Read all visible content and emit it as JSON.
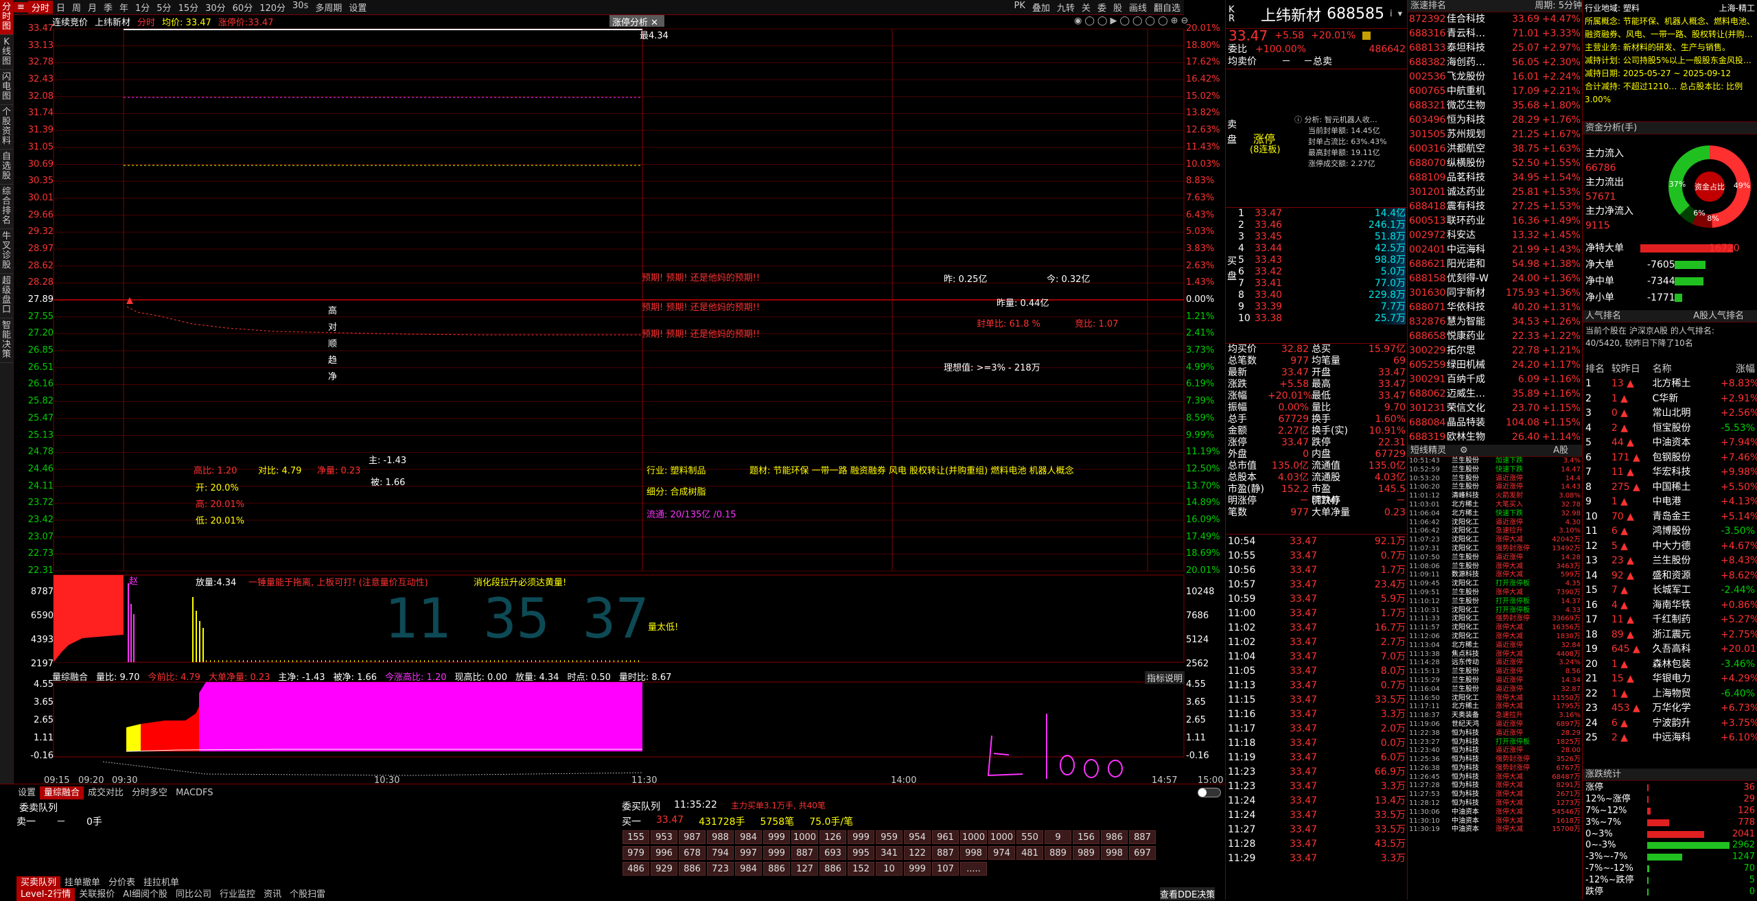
{
  "sidebar": [
    "分时图",
    "K线图",
    "闪电图",
    "个股资料",
    "自选股",
    "综合排名",
    "牛叉诊股",
    "超级盘口",
    "智能决策"
  ],
  "toolbar": {
    "items": [
      "分时",
      "日",
      "周",
      "月",
      "季",
      "年",
      "1分",
      "5分",
      "15分",
      "30分",
      "60分",
      "120分",
      "30s",
      "多周期",
      "设置"
    ],
    "right": [
      "PK",
      "叠加",
      "九转",
      "关",
      "委",
      "股",
      "画线",
      "翻自选"
    ]
  },
  "header2": {
    "tab1": "连续竞价",
    "tab2": "上纬新材",
    "fenshi": "分时",
    "avg_label": "均价: 33.47",
    "rise_label": "涨停价:33.47",
    "analysis_tab": "涨停分析",
    "peak": "最4.34"
  },
  "y_left": [
    "33.47",
    "33.13",
    "32.78",
    "32.43",
    "32.08",
    "31.74",
    "31.39",
    "31.05",
    "30.69",
    "30.35",
    "30.01",
    "29.66",
    "29.32",
    "28.97",
    "28.62",
    "28.28",
    "27.89",
    "27.55",
    "27.20",
    "26.85",
    "26.51",
    "26.16",
    "25.82",
    "25.47",
    "25.13",
    "24.78",
    "24.46",
    "24.11",
    "23.72",
    "23.42",
    "23.07",
    "22.73",
    "22.31"
  ],
  "y_right": [
    "20.01%",
    "18.80%",
    "17.62%",
    "16.42%",
    "15.02%",
    "13.82%",
    "12.63%",
    "11.43%",
    "10.03%",
    "8.83%",
    "7.63%",
    "6.43%",
    "5.03%",
    "3.83%",
    "2.63%",
    "1.43%",
    "0.00%",
    "1.21%",
    "2.41%",
    "3.73%",
    "4.99%",
    "6.19%",
    "7.39%",
    "8.59%",
    "9.99%",
    "11.19%",
    "12.50%",
    "13.70%",
    "14.89%",
    "16.09%",
    "17.49%",
    "18.69%",
    "20.01%"
  ],
  "vol_left": [
    "8787",
    "6590",
    "4393",
    "2197"
  ],
  "vol_right": [
    "10248",
    "7686",
    "5124",
    "2562"
  ],
  "ind_left": [
    "4.55",
    "3.65",
    "2.65",
    "1.11",
    "-0.16"
  ],
  "ind_right": [
    "4.55",
    "3.65",
    "2.65",
    "1.11",
    "-0.16"
  ],
  "time_axis": [
    "09:15",
    "09:20",
    "09:30",
    "10:30",
    "11:30",
    "14:00",
    "14:57",
    "15:00"
  ],
  "annotations": {
    "warn1": "预期! 预期! 还是他妈的预期!!",
    "warn2": "预期! 预期! 还是他妈的预期!!",
    "warn3": "预期! 预期! 还是他妈的预期!!",
    "zuo": "昨: 0.25亿",
    "jin": "今: 0.32亿",
    "zuoliang": "昨量: 0.44亿",
    "fengdan": "封单比: 61.8 %",
    "jingbi": "竞比: 1.07",
    "lixiang": "理想值: >=3% - 218万",
    "vert": [
      "高",
      "对",
      "顺",
      "趋",
      "净"
    ],
    "gaobi": "高比: 1.20",
    "duibi": "对比: 4.79",
    "jingliang": "净量: 0.23",
    "zhu": "主: -1.43",
    "bei": "被: 1.66",
    "kai": "开: 20.0%",
    "gao": "高: 20.01%",
    "di": "低: 20.01%",
    "hangye": "行业: 塑料制品",
    "ticai": "题材: 节能环保 一带一路 融资融券 风电 股权转让(并购重组) 燃料电池 机器人概念",
    "xifen": "细分: 合成树脂",
    "liutong": "流通: 20/135亿 /0.15",
    "fangliang": "放量:4.34",
    "tip1": "一锤量能于拖离, 上板可打! (注意量价互动性)",
    "tip2": "消化段拉升必须达黄量!",
    "liangtai": "量太低!",
    "bigclock": "11 35 37",
    "zhao": "赵"
  },
  "ind_bar": {
    "name": "量综融合",
    "lb": "量比: 9.70",
    "jrb": "今前比: 4.79",
    "dd": "大单净量: 0.23",
    "zj": "主净: -1.43",
    "bj": "被净: 1.66",
    "jjgb": "今涨高比: 1.20",
    "xgb": "现高比: 0.00",
    "fl": "放量: 4.34",
    "sd": "时点: 0.50",
    "lb2": "量时比: 8.67",
    "help": "指标说明"
  },
  "bottom": {
    "tabs1": [
      "设置",
      "量综融合",
      "成交对比",
      "分时多空",
      "MACDFS"
    ],
    "wtdl": "委卖队列",
    "mai1": "卖一",
    "mai1v": "－",
    "mai1c": "0手",
    "tabs2": [
      "买卖队列",
      "挂单撤单",
      "分价表",
      "挂拉机单"
    ],
    "tabs3": [
      "Level-2行情",
      "关联报价",
      "AI细阅个股",
      "同比公司",
      "行业监控",
      "资讯",
      "个股扫雷"
    ],
    "queue_title": "委买队列",
    "queue_time": "11:35:22",
    "queue_sub": "主力买单3.1万手, 共40笔",
    "buy1": "买一",
    "buy1p": "33.47",
    "buy1v": "431728手",
    "buy1n": "5758笔",
    "buy1avg": "75.0手/笔",
    "row1": [
      "155",
      "953",
      "987",
      "988",
      "984",
      "999",
      "1000",
      "126",
      "999",
      "959",
      "954",
      "961",
      "1000",
      "1000",
      "550",
      "9",
      "156",
      "986",
      "887"
    ],
    "row2": [
      "979",
      "996",
      "678",
      "794",
      "997",
      "999",
      "887",
      "693",
      "995",
      "341",
      "122",
      "887",
      "998",
      "974",
      "481",
      "889",
      "989",
      "998",
      "697"
    ],
    "row3": [
      "486",
      "929",
      "886",
      "723",
      "984",
      "886",
      "127",
      "886",
      "152",
      "10",
      "999",
      "107",
      "....."
    ],
    "dde": "查看DDE决策"
  },
  "quote": {
    "name": "上纬新材",
    "code": "688585",
    "price": "33.47",
    "chg": "+5.58",
    "pct": "+20.01%",
    "weibi_lbl": "委比",
    "weibi": "+100.00%",
    "weibi_v": "486642",
    "junmai_lbl": "均卖价",
    "junmai_v": "－",
    "zongmai_lbl": "－总卖",
    "zt": "涨停",
    "zt_sub": "(8连板)",
    "ana_title": "分析: 智元机器人收…",
    "ana1": "当前封单额: 14.45亿",
    "ana2": "封单占流比: 63%.43%",
    "ana3": "最高封单额: 19.11亿",
    "ana4": "涨停成交额: 2.27亿",
    "maisell_lbl": "卖盘",
    "buys": [
      [
        "1",
        "33.47",
        "14.4亿"
      ],
      [
        "2",
        "33.46",
        "246.1万"
      ],
      [
        "3",
        "33.45",
        "51.8万"
      ],
      [
        "4",
        "33.44",
        "42.5万"
      ],
      [
        "5",
        "33.43",
        "98.8万"
      ],
      [
        "6",
        "33.42",
        "5.0万"
      ],
      [
        "7",
        "33.41",
        "77.0万"
      ],
      [
        "8",
        "33.40",
        "229.8万"
      ],
      [
        "9",
        "33.39",
        "7.7万"
      ],
      [
        "10",
        "33.38",
        "25.7万"
      ]
    ],
    "buy_lbl": "买盘",
    "stats": [
      [
        "均买价",
        "32.82",
        "总买",
        "15.97亿"
      ],
      [
        "总笔数",
        "977",
        "均笔量",
        "69"
      ],
      [
        "最新",
        "33.47",
        "开盘",
        "33.47"
      ],
      [
        "涨跌",
        "+5.58",
        "最高",
        "33.47"
      ],
      [
        "涨幅",
        "+20.01%",
        "最低",
        "33.47"
      ],
      [
        "振幅",
        "0.00%",
        "量比",
        "9.70"
      ],
      [
        "总手",
        "67729",
        "换手",
        "1.60%"
      ],
      [
        "金额",
        "2.27亿",
        "换手(实)",
        "10.91%"
      ],
      [
        "涨停",
        "33.47",
        "跌停",
        "22.31"
      ],
      [
        "外盘",
        "0",
        "内盘",
        "67729"
      ],
      [
        "总市值",
        "135.0亿",
        "流通值",
        "135.0亿"
      ],
      [
        "总股本",
        "4.03亿",
        "流通股",
        "4.03亿"
      ],
      [
        "市盈(静)",
        "152.2",
        "市盈(TTM)",
        "145.5"
      ],
      [
        "明涨停",
        "－",
        "明跌停",
        "－"
      ],
      [
        "笔数",
        "977",
        "大单净量",
        "0.23"
      ]
    ],
    "ticks": [
      [
        "10:54",
        "33.47",
        "92.1万"
      ],
      [
        "10:55",
        "33.47",
        "0.7万"
      ],
      [
        "10:56",
        "33.47",
        "1.7万"
      ],
      [
        "10:57",
        "33.47",
        "23.4万"
      ],
      [
        "10:59",
        "33.47",
        "5.9万"
      ],
      [
        "11:00",
        "33.47",
        "1.7万"
      ],
      [
        "11:02",
        "33.47",
        "16.7万"
      ],
      [
        "11:02",
        "33.47",
        "2.7万"
      ],
      [
        "11:04",
        "33.47",
        "7.0万"
      ],
      [
        "11:05",
        "33.47",
        "8.0万"
      ],
      [
        "11:13",
        "33.47",
        "0.7万"
      ],
      [
        "11:15",
        "33.47",
        "33.5万"
      ],
      [
        "11:16",
        "33.47",
        "3.3万"
      ],
      [
        "11:17",
        "33.47",
        "2.0万"
      ],
      [
        "11:18",
        "33.47",
        "0.0万"
      ],
      [
        "11:19",
        "33.47",
        "6.0万"
      ],
      [
        "11:23",
        "33.47",
        "66.9万"
      ],
      [
        "11:23",
        "33.47",
        "3.3万"
      ],
      [
        "11:24",
        "33.47",
        "13.4万"
      ],
      [
        "11:24",
        "33.47",
        "33.5万"
      ],
      [
        "11:27",
        "33.47",
        "33.5万"
      ],
      [
        "11:28",
        "33.47",
        "43.5万"
      ],
      [
        "11:29",
        "33.47",
        "3.3万"
      ]
    ]
  },
  "watch": {
    "head1": "涨速排名",
    "head2": "周期: 5分钟",
    "list": [
      [
        "872392",
        "佳合科技",
        "33.69",
        "+4.47%"
      ],
      [
        "688316",
        "青云科…",
        "71.01",
        "+3.33%"
      ],
      [
        "688133",
        "泰坦科技",
        "25.07",
        "+2.97%"
      ],
      [
        "688382",
        "海创药…",
        "56.05",
        "+2.30%"
      ],
      [
        "002536",
        "飞龙股份",
        "16.01",
        "+2.24%"
      ],
      [
        "600765",
        "中航重机",
        "17.09",
        "+2.21%"
      ],
      [
        "688321",
        "微芯生物",
        "35.68",
        "+1.80%"
      ],
      [
        "603496",
        "恒为科技",
        "28.29",
        "+1.76%"
      ],
      [
        "301505",
        "苏州规划",
        "21.25",
        "+1.67%"
      ],
      [
        "600316",
        "洪都航空",
        "38.75",
        "+1.63%"
      ],
      [
        "688070",
        "纵横股份",
        "52.50",
        "+1.55%"
      ],
      [
        "688109",
        "品茗科技",
        "34.95",
        "+1.54%"
      ],
      [
        "301201",
        "诚达药业",
        "25.81",
        "+1.53%"
      ],
      [
        "688418",
        "震有科技",
        "27.25",
        "+1.53%"
      ],
      [
        "600513",
        "联环药业",
        "16.36",
        "+1.49%"
      ],
      [
        "002972",
        "科安达",
        "13.32",
        "+1.45%"
      ],
      [
        "002401",
        "中远海科",
        "21.99",
        "+1.43%"
      ],
      [
        "688621",
        "阳光诺和",
        "54.98",
        "+1.38%"
      ],
      [
        "688158",
        "优刻得-W",
        "24.00",
        "+1.36%"
      ],
      [
        "301630",
        "同宇新材",
        "175.93",
        "+1.36%"
      ],
      [
        "688071",
        "华依科技",
        "40.20",
        "+1.31%"
      ],
      [
        "832876",
        "慧为智能",
        "34.53",
        "+1.26%"
      ],
      [
        "688658",
        "悦康药业",
        "22.33",
        "+1.22%"
      ],
      [
        "300229",
        "拓尔思",
        "22.78",
        "+1.21%"
      ],
      [
        "605259",
        "绿田机械",
        "24.20",
        "+1.17%"
      ],
      [
        "300291",
        "百纳千成",
        "6.09",
        "+1.16%"
      ],
      [
        "688062",
        "迈威生…",
        "35.89",
        "+1.16%"
      ],
      [
        "301231",
        "荣信文化",
        "23.70",
        "+1.15%"
      ],
      [
        "688084",
        "晶品特装",
        "104.08",
        "+1.15%"
      ],
      [
        "688319",
        "欧林生物",
        "26.40",
        "+1.14%"
      ]
    ],
    "jl_head": "短线精灵",
    "jl_sel": "A股",
    "jl": [
      [
        "10:51:43",
        "兰生股份",
        "加速下跌",
        "3.4%"
      ],
      [
        "10:52:59",
        "兰生股份",
        "快速下跌",
        "14.47"
      ],
      [
        "10:53:20",
        "兰生股份",
        "逼近涨停",
        "14.4"
      ],
      [
        "11:00:20",
        "兰生股份",
        "逼近涨停",
        "14.43"
      ],
      [
        "11:01:12",
        "清峰科技",
        "火箭发射",
        "3.08%"
      ],
      [
        "11:03:01",
        "北方稀土",
        "大笔买入",
        "32.78"
      ],
      [
        "11:06:04",
        "北方稀土",
        "快速下跌",
        "32.98"
      ],
      [
        "11:06:42",
        "沈阳化工",
        "逼近涨停",
        "4.30"
      ],
      [
        "11:06:42",
        "沈阳化工",
        "急速拉升",
        "3.10%"
      ],
      [
        "11:07:23",
        "沈阳化工",
        "涨停大减",
        "42042万"
      ],
      [
        "11:07:31",
        "沈阳化工",
        "强势封涨停",
        "13492万"
      ],
      [
        "11:07:50",
        "兰生股份",
        "逼近涨停",
        "14.28"
      ],
      [
        "11:08:06",
        "兰生股份",
        "涨停大减",
        "3463万"
      ],
      [
        "11:09:11",
        "数源科技",
        "涨停大减",
        "599万"
      ],
      [
        "11:09:45",
        "沈阳化工",
        "打开涨停板",
        "4.35"
      ],
      [
        "11:09:51",
        "兰生股份",
        "涨停大减",
        "7390万"
      ],
      [
        "11:10:12",
        "兰生股份",
        "打开涨停板",
        "14.37"
      ],
      [
        "11:10:31",
        "沈阳化工",
        "打开涨停板",
        "4.33"
      ],
      [
        "11:11:33",
        "沈阳化工",
        "强势封涨停",
        "33669万"
      ],
      [
        "11:11:57",
        "沈阳化工",
        "涨停大减",
        "16356万"
      ],
      [
        "11:12:06",
        "沈阳化工",
        "涨停大减",
        "1830万"
      ],
      [
        "11:13:04",
        "北方稀土",
        "逼近涨停",
        "32.84"
      ],
      [
        "11:13:38",
        "焦点科技",
        "涨停大减",
        "4408万"
      ],
      [
        "11:14:28",
        "远东传动",
        "逼近涨停",
        "3.24%"
      ],
      [
        "11:15:13",
        "兰生股份",
        "逼近涨停",
        "8.56"
      ],
      [
        "11:15:29",
        "兰生股份",
        "逼近涨停",
        "14.34"
      ],
      [
        "11:16:04",
        "兰生股份",
        "逼近涨停",
        "32.87"
      ],
      [
        "11:16:50",
        "沈阳化工",
        "涨停大减",
        "11550万"
      ],
      [
        "11:17:11",
        "北方稀土",
        "涨停大减",
        "1795万"
      ],
      [
        "11:18:37",
        "天奥装备",
        "急速拉升",
        "3.16%"
      ],
      [
        "11:19:06",
        "世纪天鸿",
        "逼近涨停",
        "6897万"
      ],
      [
        "11:22:38",
        "恒为科技",
        "逼近涨停",
        "28.29"
      ],
      [
        "11:23:27",
        "恒为科技",
        "打开涨停板",
        "1825万"
      ],
      [
        "11:23:40",
        "恒为科技",
        "逼近涨停",
        "28.00"
      ],
      [
        "11:25:36",
        "恒为科技",
        "强势封涨停",
        "3526万"
      ],
      [
        "11:26:38",
        "恒为科技",
        "强势封涨停",
        "6767万"
      ],
      [
        "11:26:45",
        "恒为科技",
        "涨停大减",
        "68487万"
      ],
      [
        "11:27:28",
        "恒为科技",
        "涨停大减",
        "8291万"
      ],
      [
        "11:27:53",
        "恒为科技",
        "涨停大减",
        "2671万"
      ],
      [
        "11:28:12",
        "恒为科技",
        "涨停大减",
        "1273万"
      ],
      [
        "11:30:06",
        "中油资本",
        "涨停大减",
        "54546万"
      ],
      [
        "11:30:10",
        "中油资本",
        "涨停大减",
        "1618万"
      ],
      [
        "11:30:19",
        "中油资本",
        "涨停大减",
        "15700万"
      ]
    ]
  },
  "panel2": {
    "hy": "行业地域: 塑料",
    "hy2": "上海-精工",
    "sszn": "所属概念: 节能环保、机器人概念、燃料电池、融资融券、风电、一带一路、股权转让(并购…",
    "zyyw": "主营业务: 新材料的研发、生产与销售。",
    "jsjh": "减持计划: 公司持股5%以上一般股东金风投…",
    "jsrq": "减持日期: 2025-05-27 ~ 2025-09-12",
    "hjjc": "合计减持: 不超过1210…  总占股本比: 比例3.00%",
    "zj_head": "资金分析(手)",
    "zj": [
      [
        "主力流入",
        ""
      ],
      [
        "66786",
        ""
      ],
      [
        "主力流出",
        ""
      ],
      [
        "57671",
        ""
      ],
      [
        "主力净流入",
        ""
      ],
      [
        "9115",
        ""
      ]
    ],
    "donut": {
      "in": "37%",
      "out": "49%",
      "mid1": "6%",
      "mid2": "8%",
      "center": "资金占比"
    },
    "jt": [
      [
        "净特大单",
        "16720"
      ],
      [
        "净大单",
        "-7605"
      ],
      [
        "净中单",
        "-7344"
      ],
      [
        "净小单",
        "-1771"
      ]
    ],
    "rq_head": "人气排名",
    "rq_sel": "A股人气排名",
    "rq_sub": "当前个股在 沪深京A股 的人气排名:",
    "rq_sub2": "40/5420, 较昨日下降了10名",
    "rq_cols": [
      "排名",
      "较昨日",
      "名称",
      "涨幅"
    ],
    "rq": [
      [
        "1",
        "13",
        "北方稀土",
        "+8.83%"
      ],
      [
        "2",
        "1",
        "C华新",
        "+2.91%"
      ],
      [
        "3",
        "0",
        "常山北明",
        "+2.56%"
      ],
      [
        "4",
        "2",
        "恒宝股份",
        "-5.53%"
      ],
      [
        "5",
        "44",
        "中油资本",
        "+7.94%"
      ],
      [
        "6",
        "171",
        "包钢股份",
        "+7.46%"
      ],
      [
        "7",
        "11",
        "华宏科技",
        "+9.98%"
      ],
      [
        "8",
        "275",
        "中国稀土",
        "+5.50%"
      ],
      [
        "9",
        "1",
        "中电港",
        "+4.13%"
      ],
      [
        "10",
        "70",
        "青岛金王",
        "+5.14%"
      ],
      [
        "11",
        "6",
        "鸿博股份",
        "-3.50%"
      ],
      [
        "12",
        "5",
        "中大力德",
        "+4.67%"
      ],
      [
        "13",
        "23",
        "兰生股份",
        "+8.43%"
      ],
      [
        "14",
        "92",
        "盛和资源",
        "+8.62%"
      ],
      [
        "15",
        "7",
        "长城军工",
        "-2.44%"
      ],
      [
        "16",
        "4",
        "海南华铁",
        "+0.86%"
      ],
      [
        "17",
        "11",
        "千红制药",
        "+5.27%"
      ],
      [
        "18",
        "89",
        "浙江震元",
        "+2.75%"
      ],
      [
        "19",
        "645",
        "久吾高科",
        "+20.01%"
      ],
      [
        "20",
        "1",
        "森林包装",
        "-3.46%"
      ],
      [
        "21",
        "15",
        "华银电力",
        "+4.29%"
      ],
      [
        "22",
        "1",
        "上海物贸",
        "-6.40%"
      ],
      [
        "23",
        "453",
        "万华化学",
        "+6.73%"
      ],
      [
        "24",
        "6",
        "宁波韵升",
        "+3.75%"
      ],
      [
        "25",
        "2",
        "中远海科",
        "+6.10%"
      ]
    ],
    "zt_head": "涨跌统计",
    "zt": [
      [
        "涨停",
        "36"
      ],
      [
        "12%~涨停",
        "29"
      ],
      [
        "7%~12%",
        "126"
      ],
      [
        "3%~7%",
        "778"
      ],
      [
        "0~3%",
        "2041"
      ],
      [
        "0~-3%",
        "2962"
      ],
      [
        "-3%~-7%",
        "1247"
      ],
      [
        "-7%~-12%",
        "70"
      ],
      [
        "-12%~跌停",
        "5"
      ],
      [
        "跌停",
        "0"
      ]
    ]
  }
}
